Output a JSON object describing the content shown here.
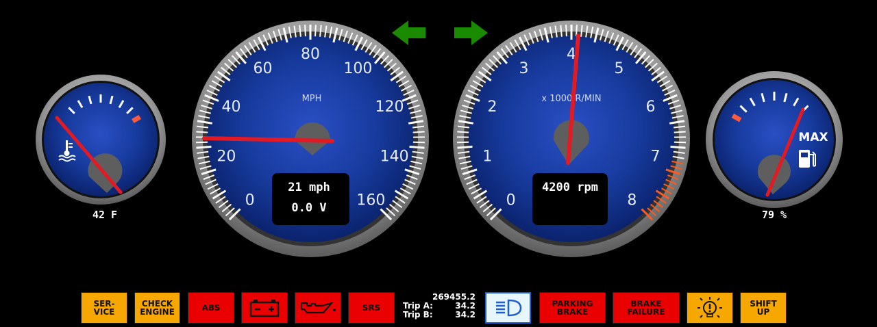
{
  "temp_gauge": {
    "value_text": "42  F",
    "icon": "coolant-temperature-icon",
    "needle_fraction": 0.0
  },
  "speedometer": {
    "unit_label": "MPH",
    "tick_labels": [
      "0",
      "20",
      "40",
      "60",
      "80",
      "100",
      "120",
      "140",
      "160"
    ],
    "readout_speed": "21 mph",
    "readout_voltage": "0.0 V",
    "speed": 21,
    "max": 160
  },
  "turn_signals": {
    "left": "left-arrow-icon",
    "right": "right-arrow-icon",
    "color": "#1a8a00"
  },
  "tachometer": {
    "unit_label": "x 1000 R/MIN",
    "tick_labels": [
      "0",
      "1",
      "2",
      "3",
      "4",
      "5",
      "6",
      "7",
      "8"
    ],
    "readout_rpm": "4200 rpm",
    "rpm": 4200,
    "redline_start": 7000
  },
  "fuel_gauge": {
    "value_text": "79 %",
    "max_label": "MAX",
    "icon": "fuel-pump-icon",
    "level_percent": 79
  },
  "warning_lamps": [
    {
      "name": "service",
      "label": "SER-\nVICE",
      "color": "yellow"
    },
    {
      "name": "check-engine",
      "label": "CHECK\nENGINE",
      "color": "yellow"
    },
    {
      "name": "abs",
      "label": "ABS",
      "color": "red"
    },
    {
      "name": "battery",
      "icon": "battery-icon",
      "color": "red"
    },
    {
      "name": "oil",
      "icon": "oil-can-icon",
      "color": "red"
    },
    {
      "name": "srs",
      "label": "SRS",
      "color": "red"
    },
    {
      "name": "headlight",
      "icon": "headlight-icon",
      "color": "white"
    },
    {
      "name": "parking-brake",
      "label": "PARKING\nBRAKE",
      "color": "red"
    },
    {
      "name": "brake-failure",
      "label": "BRAKE\nFAILURE",
      "color": "red"
    },
    {
      "name": "bulb-warning",
      "icon": "bulb-warning-icon",
      "color": "yellow"
    },
    {
      "name": "shift-up",
      "label": "SHIFT\nUP",
      "color": "yellow"
    }
  ],
  "odometer": {
    "total": "269455.2",
    "trip_a_label": "Trip A:",
    "trip_a": "34.2",
    "trip_b_label": "Trip B:",
    "trip_b": "34.2"
  },
  "colors": {
    "dial_blue": "#102e8c",
    "needle_red": "#e11a24",
    "bezel": "#9a9a9a",
    "lamp_yellow": "#f6a800",
    "lamp_red": "#ea0000"
  }
}
